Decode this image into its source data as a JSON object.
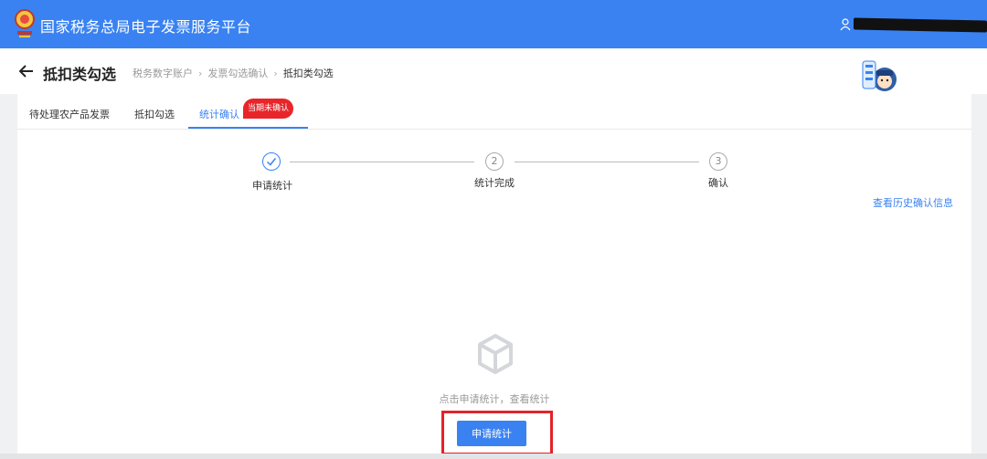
{
  "app": {
    "title": "国家税务总局电子发票服务平台"
  },
  "header": {
    "user_name_hidden": true
  },
  "page": {
    "title": "抵扣类勾选",
    "breadcrumb": [
      "税务数字账户",
      "发票勾选确认",
      "抵扣类勾选"
    ]
  },
  "tabs": [
    {
      "label": "待处理农产品发票",
      "active": false
    },
    {
      "label": "抵扣勾选",
      "active": false
    },
    {
      "label": "统计确认",
      "active": true,
      "badge": "当期未确认"
    }
  ],
  "steps": [
    {
      "number": "1",
      "label": "申请统计",
      "status": "done"
    },
    {
      "number": "2",
      "label": "统计完成",
      "status": "pending"
    },
    {
      "number": "3",
      "label": "确认",
      "status": "pending"
    }
  ],
  "links": {
    "history": "查看历史确认信息"
  },
  "empty_state": {
    "message": "点击申请统计，查看统计",
    "button_label": "申请统计",
    "icon": "empty-box-icon"
  },
  "colors": {
    "primary": "#3a82f1",
    "highlight": "#e32229",
    "badge": "#e8262a"
  }
}
